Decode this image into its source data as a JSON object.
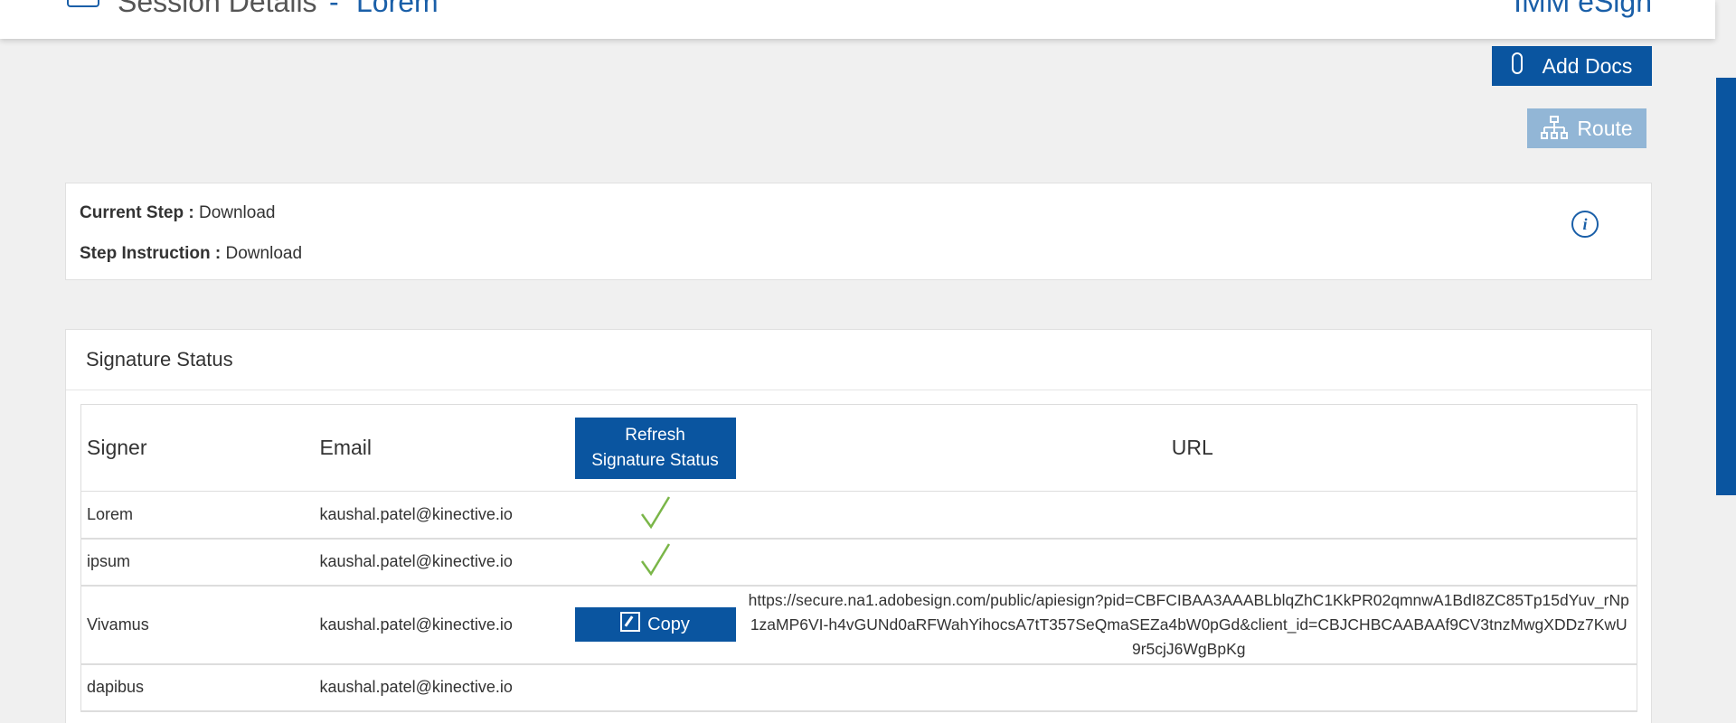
{
  "header": {
    "title": "Session Details",
    "separator": "-",
    "subtitle": "Lorem",
    "brand": "IMM eSign"
  },
  "actions": {
    "add_docs": "Add Docs",
    "route": "Route"
  },
  "step": {
    "current_label": "Current Step :",
    "current_value": "Download",
    "instruction_label": "Step Instruction :",
    "instruction_value": "Download"
  },
  "signature": {
    "title": "Signature Status",
    "columns": {
      "signer": "Signer",
      "email": "Email",
      "refresh_line1": "Refresh",
      "refresh_line2": "Signature Status",
      "url": "URL"
    },
    "rows": [
      {
        "signer": "Lorem",
        "email": "kaushal.patel@kinective.io",
        "status": "signed"
      },
      {
        "signer": "ipsum",
        "email": "kaushal.patel@kinective.io",
        "status": "signed"
      },
      {
        "signer": "Vivamus",
        "email": "kaushal.patel@kinective.io",
        "status": "pending",
        "copy_label": "Copy",
        "url": "https://secure.na1.adobesign.com/public/apiesign?pid=CBFCIBAA3AAABLblqZhC1KkPR02qmnwA1BdI8ZC85Tp15dYuv_rNp1zaMP6VI-h4vGUNd0aRFWahYihocsA7tT357SeQmaSEZa4bW0pGd&client_id=CBJCHBCAABAAf9CV3tnzMwgXDDz7KwU9r5cjJ6WgBpKg"
      },
      {
        "signer": "dapibus",
        "email": "kaushal.patel@kinective.io",
        "status": "none"
      }
    ]
  },
  "colors": {
    "primary": "#0a55a0",
    "primary_disabled": "#92b6d6",
    "check": "#7ab648",
    "background": "#f0f0f0"
  },
  "icons": {
    "add_docs": "paperclip-icon",
    "route": "hierarchy-icon",
    "info": "info-icon",
    "signed": "checkmark-icon",
    "copy": "edit-copy-icon"
  }
}
